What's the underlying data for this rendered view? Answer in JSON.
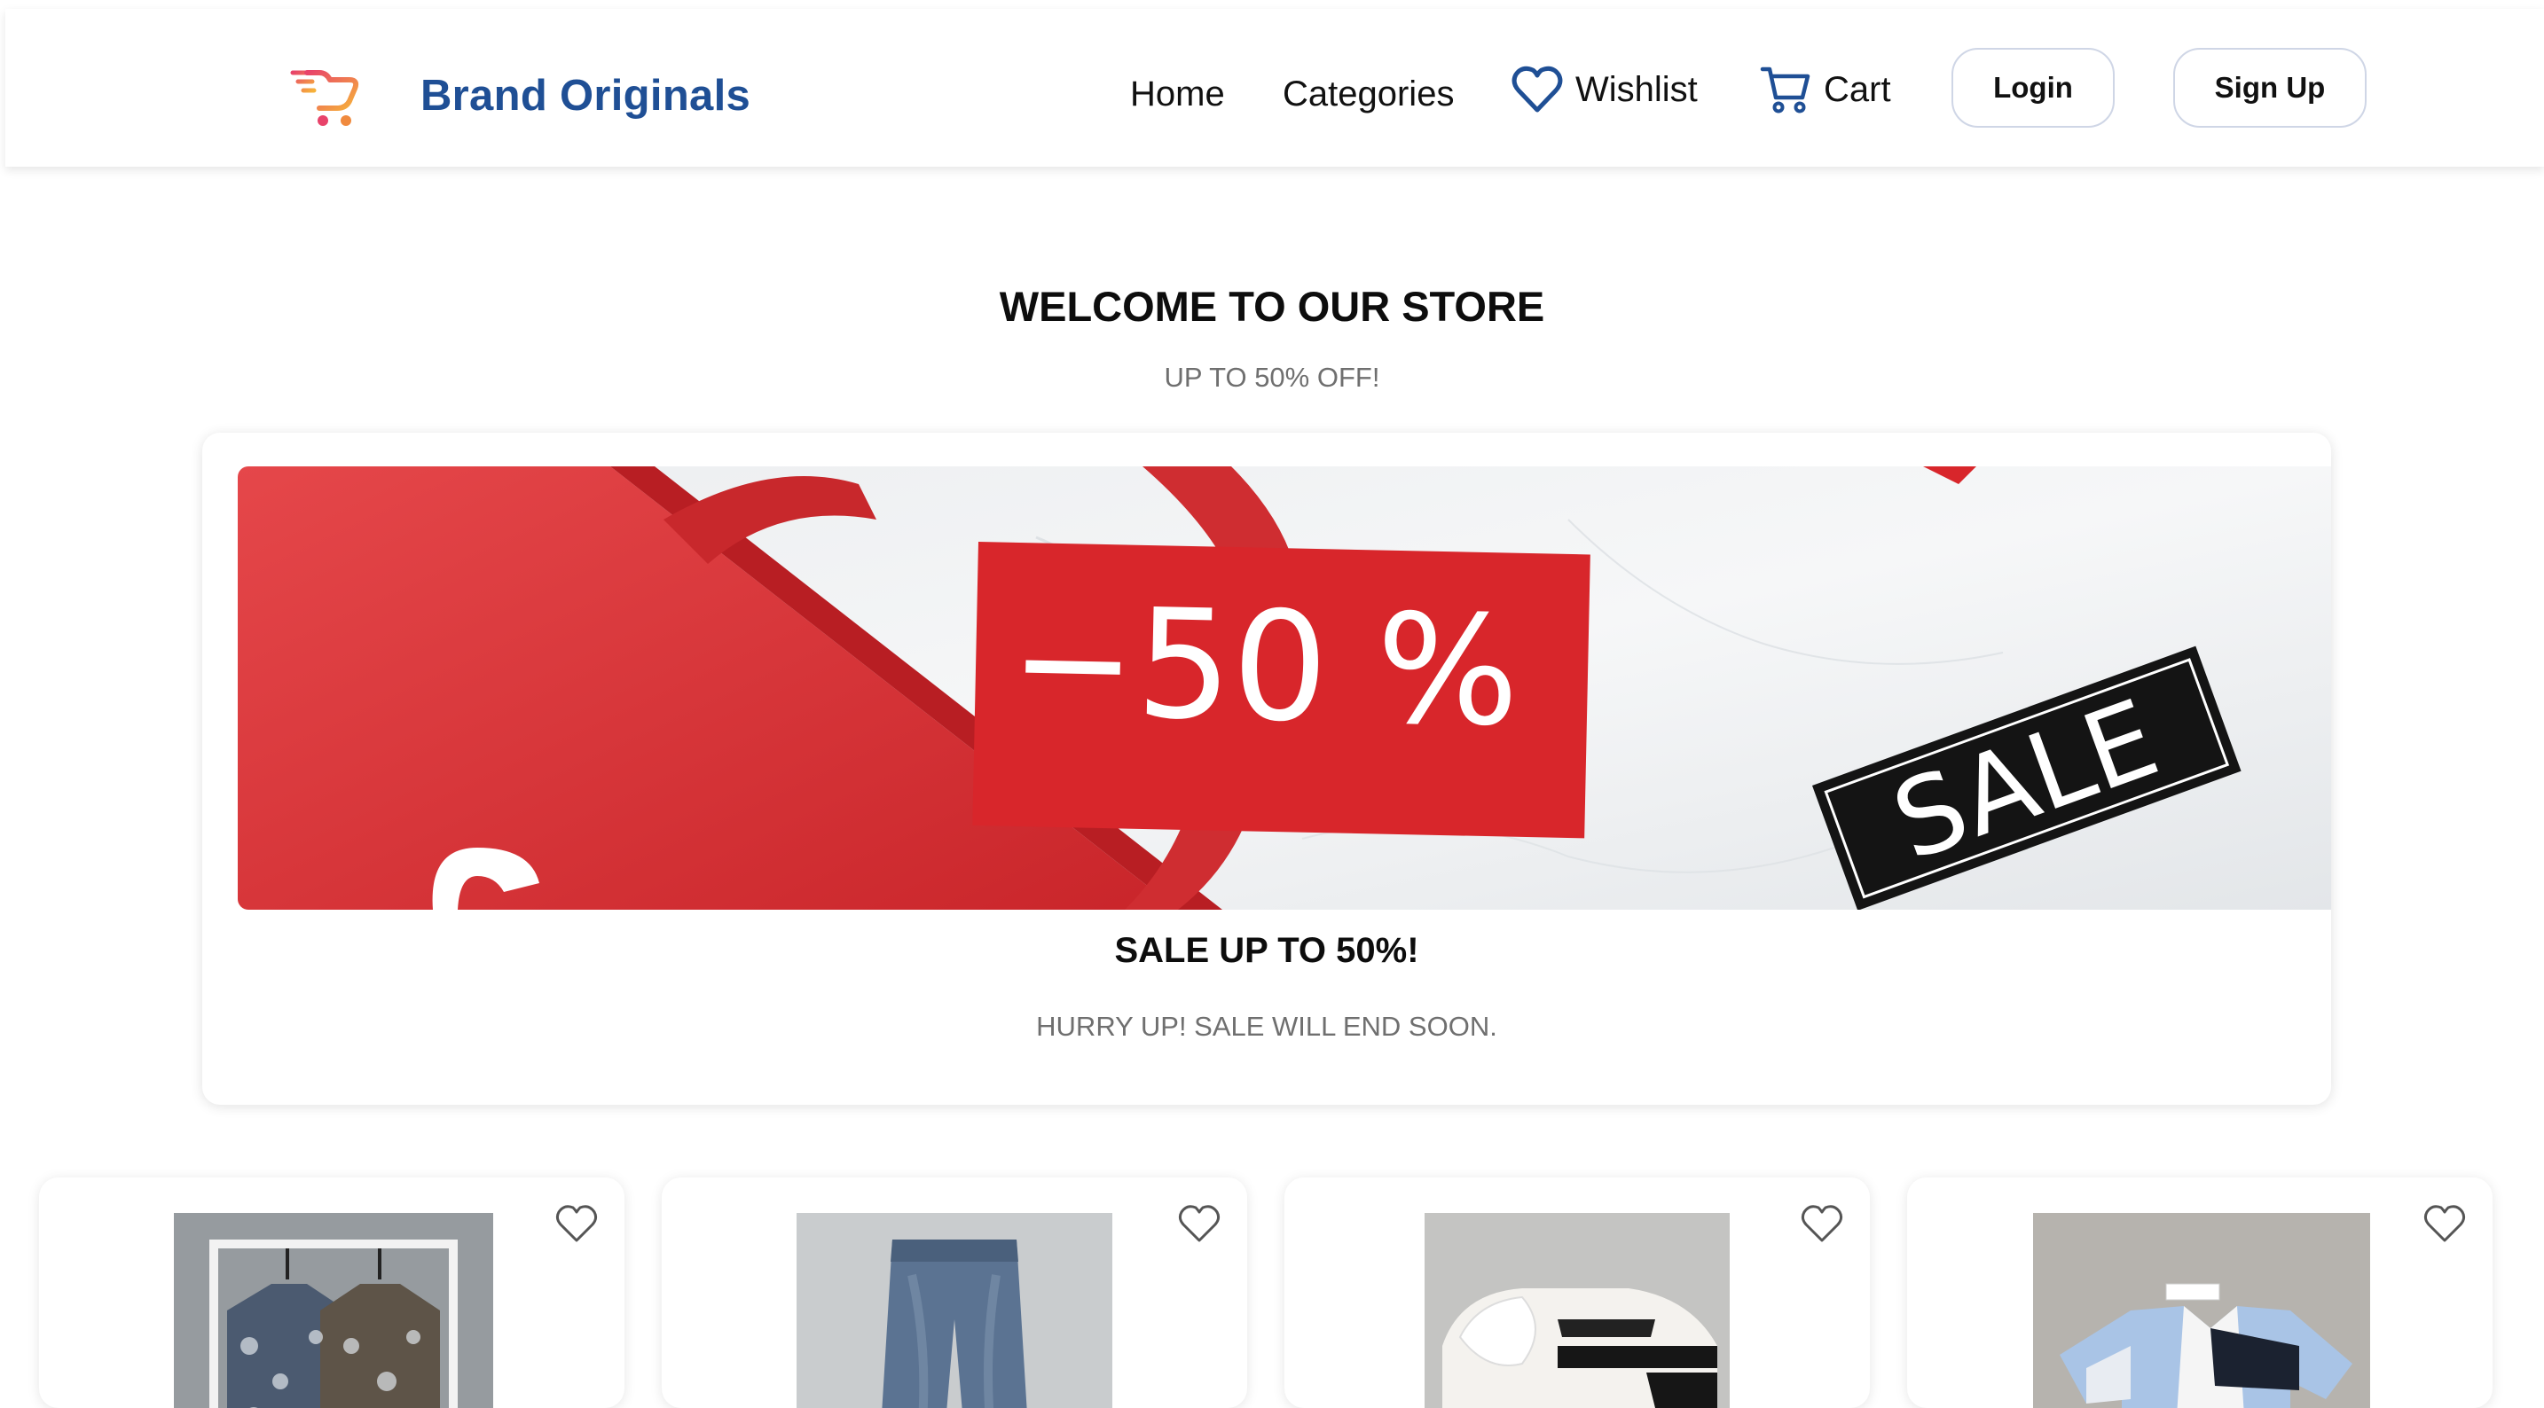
{
  "brand": {
    "name": "Brand Originals",
    "logo_icon": "shopping-cart-logo-icon",
    "color": "#1f4f95"
  },
  "nav": {
    "home": "Home",
    "categories": "Categories",
    "wishlist": "Wishlist",
    "cart": "Cart",
    "login": "Login",
    "signup": "Sign Up",
    "icon_color": "#1f4f95"
  },
  "hero": {
    "title": "WELCOME TO OUR STORE",
    "subtitle": "UP TO 50% OFF!"
  },
  "banner": {
    "discount_text": "−50 %",
    "sale_tag": "SALE",
    "title": "SALE UP TO 50%!",
    "subtitle": "HURRY UP! SALE WILL END SOON.",
    "accent_color": "#d8262b"
  },
  "products": [
    {
      "image": "patterned-shirts-on-rack",
      "wishlist_icon": "heart-outline-icon"
    },
    {
      "image": "denim-jeans",
      "wishlist_icon": "heart-outline-icon"
    },
    {
      "image": "white-black-hoodie",
      "wishlist_icon": "heart-outline-icon"
    },
    {
      "image": "blue-white-polo-shirt",
      "wishlist_icon": "heart-outline-icon"
    }
  ]
}
